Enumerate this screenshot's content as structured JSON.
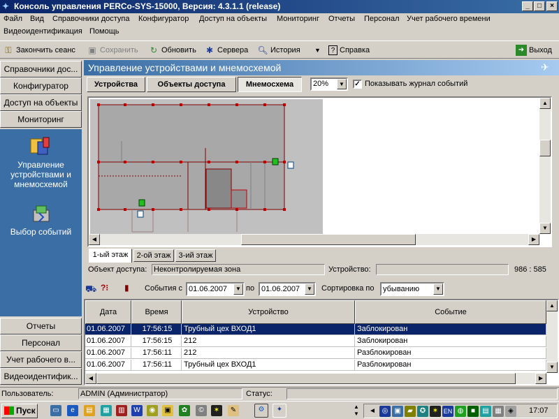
{
  "window": {
    "title": "Консоль управления PERCo-SYS-15000, Версия: 4.3.1.1 (release)",
    "minimize": "_",
    "maximize": "□",
    "close": "×"
  },
  "menu": [
    "Файл",
    "Вид",
    "Справочники доступа",
    "Конфигуратор",
    "Доступ на объекты",
    "Мониторинг",
    "Отчеты",
    "Персонал",
    "Учет рабочего времени",
    "Видеоидентификация",
    "Помощь"
  ],
  "toolbar": {
    "end_session": "Закончить сеанс",
    "save": "Сохранить",
    "refresh": "Обновить",
    "servers": "Сервера",
    "history": "История",
    "help": "Справка",
    "exit": "Выход"
  },
  "nav": {
    "top_buttons": [
      "Справочники дос...",
      "Конфигуратор",
      "Доступ на объекты",
      "Мониторинг"
    ],
    "panel_items": [
      {
        "label_lines": [
          "Управление",
          "устройствами и",
          "мнемосхемой"
        ]
      },
      {
        "label_lines": [
          "Выбор событий"
        ]
      }
    ],
    "bottom_buttons": [
      "Отчеты",
      "Персонал",
      "Учет рабочего в...",
      "Видеоидентифик..."
    ]
  },
  "main": {
    "header": "Управление устройствами и мнемосхемой",
    "tabs": [
      "Устройства",
      "Объекты доступа",
      "Мнемосхема"
    ],
    "zoom": "20%",
    "show_log_label": "Показывать журнал событий",
    "floors": [
      "1-ый этаж",
      "2-ой этаж",
      "3-ий этаж"
    ],
    "status": {
      "object_label": "Объект доступа:",
      "object_value": "Неконтролируемая зона",
      "device_label": "Устройство:",
      "device_value": "",
      "coords": "986 : 585"
    }
  },
  "events": {
    "from_label": "События с",
    "from_date": "01.06.2007",
    "to_label": "по",
    "to_date": "01.06.2007",
    "sort_label": "Сортировка по",
    "sort_value": "убыванию",
    "columns": [
      "Дата",
      "Время",
      "Устройство",
      "Событие"
    ],
    "rows": [
      {
        "date": "01.06.2007",
        "time": "17:56:15",
        "device": "Трубный цех ВХОД1",
        "event": "Заблокирован"
      },
      {
        "date": "01.06.2007",
        "time": "17:56:15",
        "device": "212",
        "event": "Заблокирован"
      },
      {
        "date": "01.06.2007",
        "time": "17:56:11",
        "device": "212",
        "event": "Разблокирован"
      },
      {
        "date": "01.06.2007",
        "time": "17:56:11",
        "device": "Трубный цех ВХОД1",
        "event": "Разблокирован"
      }
    ]
  },
  "statusbar": {
    "user_label": "Пользователь:",
    "user_value": "ADMIN (Администратор)",
    "status_label": "Статус:"
  },
  "taskbar": {
    "start": "Пуск",
    "lang": "EN",
    "clock": "17:07"
  }
}
